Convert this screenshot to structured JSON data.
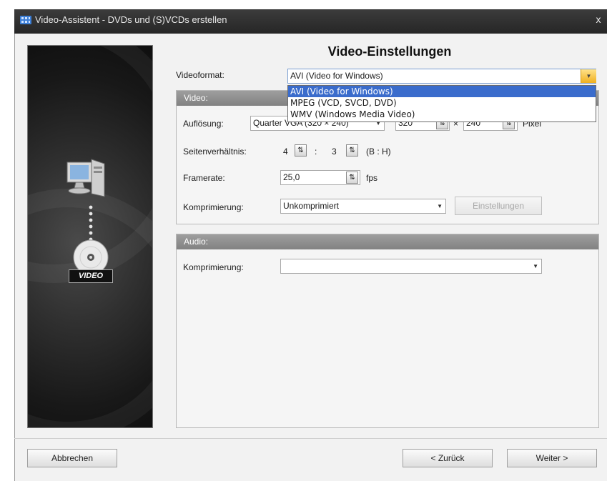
{
  "window": {
    "title": "Video-Assistent - DVDs und (S)VCDs erstellen",
    "close_glyph": "x"
  },
  "left_panel": {
    "badge": "VIDEO",
    "icons": [
      "computer-icon",
      "dotted-connector-icon",
      "disc-icon"
    ]
  },
  "heading": "Video-Einstellungen",
  "videoformat": {
    "label": "Videoformat:",
    "value": "AVI (Video for Windows)",
    "options": [
      "AVI (Video for Windows)",
      "MPEG (VCD, SVCD, DVD)",
      "WMV (Windows Media Video)"
    ],
    "selected_index": 0
  },
  "video_section": {
    "header": "Video:",
    "aufloesung": {
      "label": "Auflösung:",
      "value": "Quarter VGA (320 × 240)",
      "width": "320",
      "height": "240",
      "times": "×",
      "unit": "Pixel"
    },
    "seitenverhaeltnis": {
      "label": "Seitenverhältnis:",
      "w": "4",
      "sep": ":",
      "h": "3",
      "hint": "(B : H)"
    },
    "framerate": {
      "label": "Framerate:",
      "value": "25,0",
      "unit": "fps"
    },
    "komprimierung": {
      "label": "Komprimierung:",
      "value": "Unkomprimiert",
      "settings_button": "Einstellungen"
    }
  },
  "audio_section": {
    "header": "Audio:",
    "komprimierung": {
      "label": "Komprimierung:",
      "value": ""
    }
  },
  "buttons": {
    "cancel": "Abbrechen",
    "back": "< Zurück",
    "next": "Weiter >"
  },
  "colors": {
    "titlebar": "#2e2e2e",
    "selection": "#3a6ccc",
    "section_header": "#8f8f8f",
    "dropdown_button": "#f0b020"
  }
}
